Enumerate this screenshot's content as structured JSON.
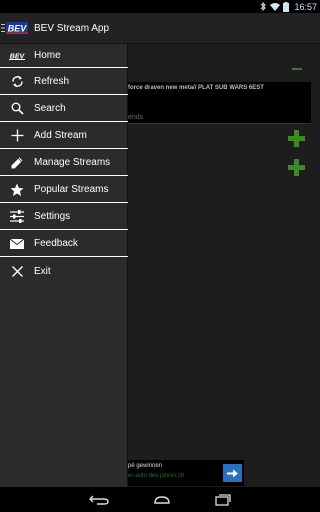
{
  "status_bar": {
    "time": "16:57"
  },
  "action_bar": {
    "title": "BEV Stream App",
    "logo_text": "BEV"
  },
  "background": {
    "stream_title": "force draven new meta// PLAT SUB WARS 6EST",
    "friends_label": "ends"
  },
  "ad": {
    "line1": "pé gewinnen",
    "line2": "er-auto des jahres.ch"
  },
  "drawer": {
    "items": [
      {
        "label": "Home",
        "icon": "bev-logo-icon"
      },
      {
        "label": "Refresh",
        "icon": "refresh-icon"
      },
      {
        "label": "Search",
        "icon": "search-icon"
      },
      {
        "label": "Add Stream",
        "icon": "plus-icon"
      },
      {
        "label": "Manage Streams",
        "icon": "pencil-icon"
      },
      {
        "label": "Popular Streams",
        "icon": "star-icon"
      },
      {
        "label": "Settings",
        "icon": "sliders-icon"
      },
      {
        "label": "Feedback",
        "icon": "envelope-icon"
      },
      {
        "label": "Exit",
        "icon": "close-icon"
      }
    ]
  },
  "colors": {
    "accent_green": "#3d8a24",
    "drawer_bg": "#2b2b2b",
    "statusbar_blue": "#cfe6f2"
  }
}
